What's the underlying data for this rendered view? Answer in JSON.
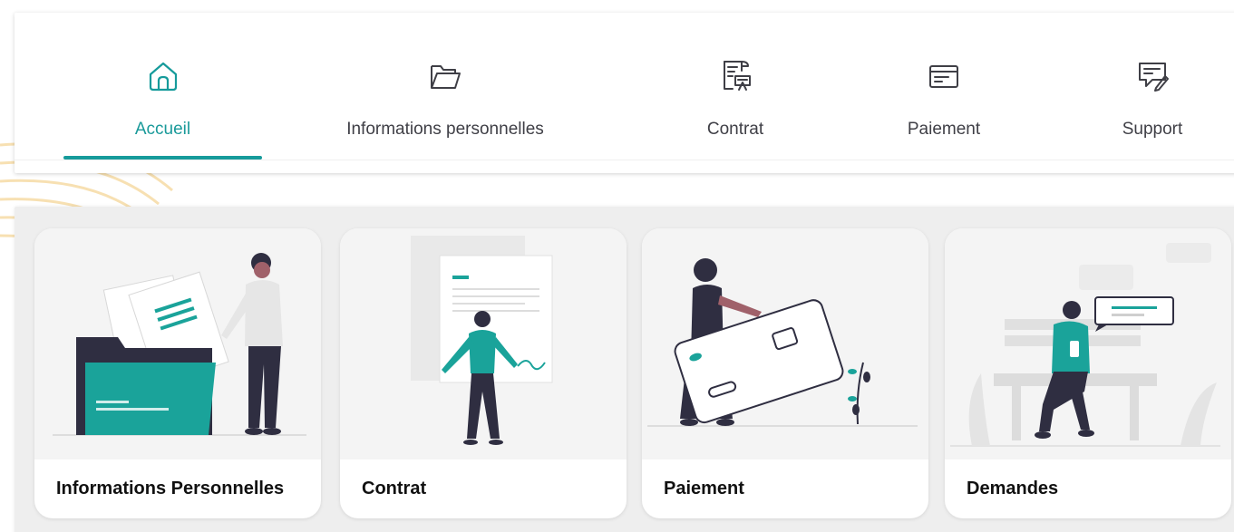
{
  "nav": {
    "items": [
      {
        "label": "Accueil",
        "icon": "home-icon",
        "active": true
      },
      {
        "label": "Informations personnelles",
        "icon": "folder-icon",
        "active": false
      },
      {
        "label": "Contrat",
        "icon": "contract-icon",
        "active": false
      },
      {
        "label": "Paiement",
        "icon": "payment-card-icon",
        "active": false
      },
      {
        "label": "Support",
        "icon": "support-chat-icon",
        "active": false
      }
    ]
  },
  "cards": [
    {
      "title": "Informations Personnelles",
      "illustration": "person-with-folder-illustration"
    },
    {
      "title": "Contrat",
      "illustration": "person-with-document-illustration"
    },
    {
      "title": "Paiement",
      "illustration": "person-with-bank-card-illustration"
    },
    {
      "title": "Demandes",
      "illustration": "person-on-bench-with-chat-illustration"
    }
  ],
  "colors": {
    "accent": "#169b9b",
    "nav_text": "#3f3f46",
    "panel_bg": "#eeeeee",
    "card_title": "#111111",
    "figure_teal": "#1aa39a",
    "figure_dark": "#2f2e41",
    "deco_arcs": "#f6d9a0"
  }
}
